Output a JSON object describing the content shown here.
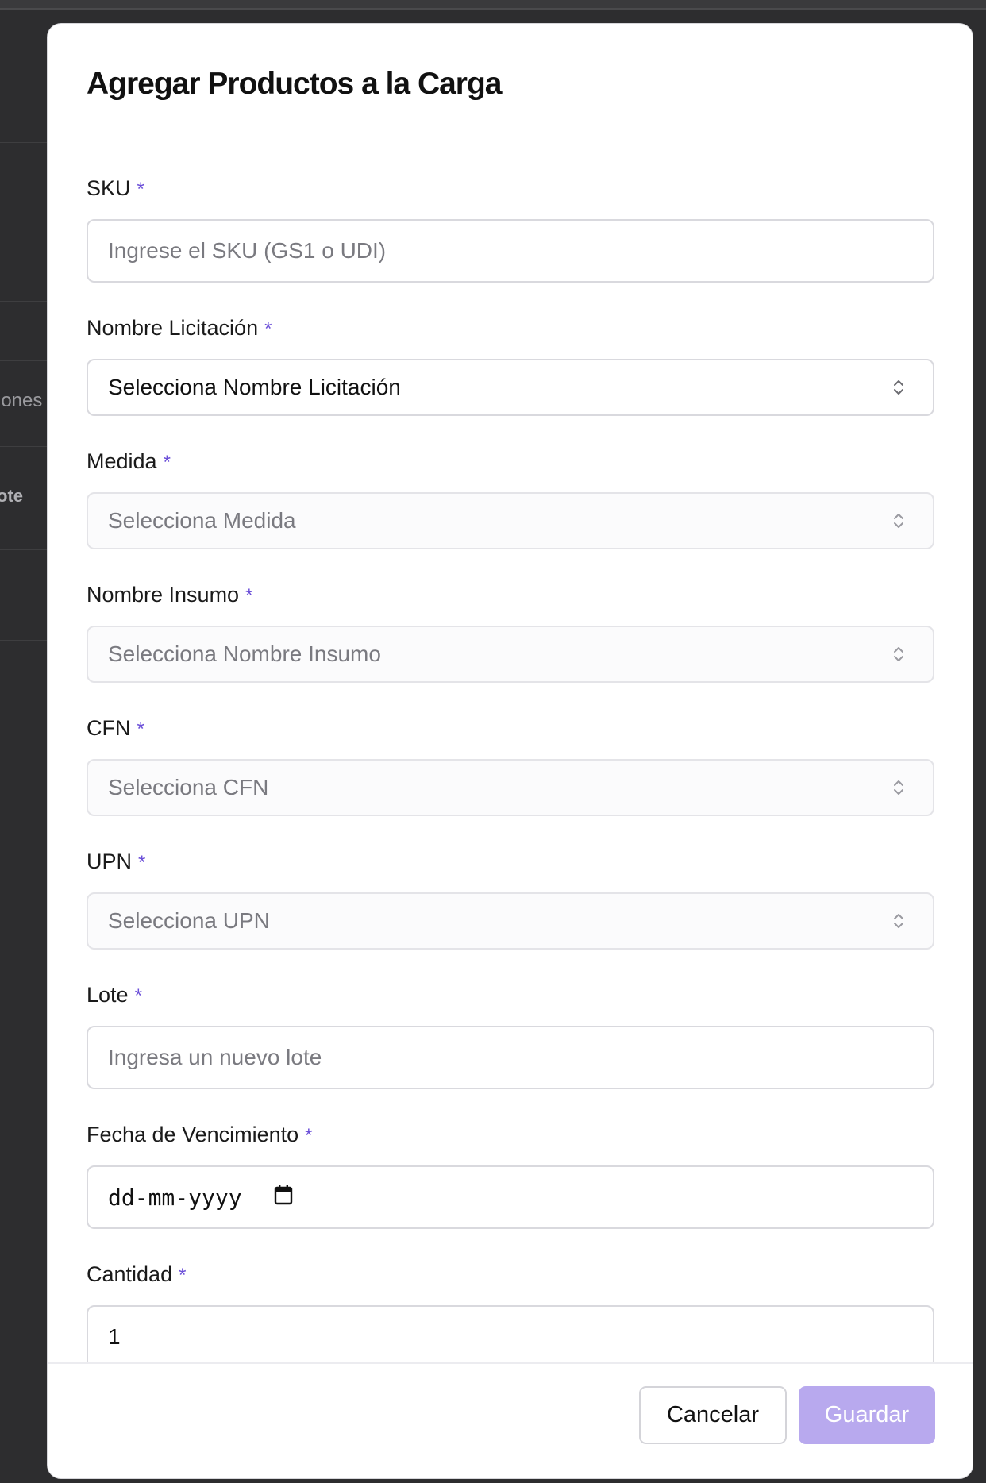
{
  "background": {
    "fragments": [
      "iones",
      "ote"
    ]
  },
  "modal": {
    "title": "Agregar Productos a la Carga",
    "required_mark": "*",
    "fields": {
      "sku": {
        "label": "SKU",
        "placeholder": "Ingrese el SKU (GS1 o UDI)"
      },
      "licitacion": {
        "label": "Nombre Licitación",
        "value": "Selecciona Nombre Licitación"
      },
      "medida": {
        "label": "Medida",
        "value": "Selecciona Medida"
      },
      "insumo": {
        "label": "Nombre Insumo",
        "value": "Selecciona Nombre Insumo"
      },
      "cfn": {
        "label": "CFN",
        "value": "Selecciona CFN"
      },
      "upn": {
        "label": "UPN",
        "value": "Selecciona UPN"
      },
      "lote": {
        "label": "Lote",
        "placeholder": "Ingresa un nuevo lote"
      },
      "fecha": {
        "label": "Fecha de Vencimiento",
        "placeholder": "dd-mm-yyyy"
      },
      "cantidad": {
        "label": "Cantidad",
        "value": "1"
      }
    },
    "footer": {
      "cancel_label": "Cancelar",
      "save_label": "Guardar"
    }
  },
  "colors": {
    "accent": "#6b4fd8",
    "save_button": "#b8a9ee",
    "backdrop": "#2d2d2f"
  },
  "icons": {
    "select": "chevron-up-down-icon",
    "date": "calendar-icon"
  }
}
